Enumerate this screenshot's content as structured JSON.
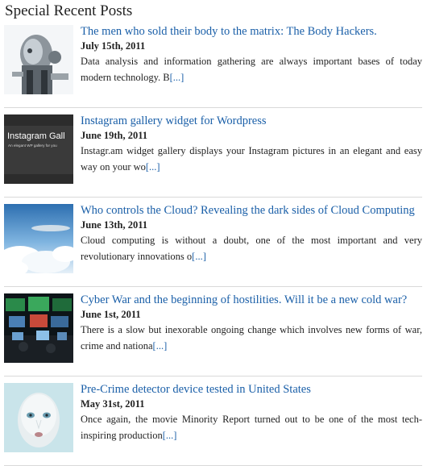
{
  "widget": {
    "title": "Special Recent Posts"
  },
  "posts": [
    {
      "title": "The men who sold their body to the matrix: The Body Hackers.",
      "date": "July 15th, 2011",
      "excerpt": "Data analysis and information gathering are always important bases of today modern technology. B",
      "more": "[...]",
      "thumb_icon": "robot-figure-thumbnail"
    },
    {
      "title": "Instagram gallery widget for Wordpress",
      "date": "June 19th, 2011",
      "excerpt": "Instagr.am widget gallery displays your Instagram pictures in an elegant and easy way on your wo",
      "more": "[...]",
      "thumb_icon": "instagram-gallery-thumbnail",
      "thumb_text": "Instagram Gall",
      "thumb_subtext": "An elegant WP gallery for you"
    },
    {
      "title": "Who controls the Cloud? Revealing the dark sides of Cloud Computing",
      "date": "June 13th, 2011",
      "excerpt": "Cloud computing is without a doubt, one of the most important and very revolutionary innovations o",
      "more": "[...]",
      "thumb_icon": "sky-clouds-thumbnail"
    },
    {
      "title": "Cyber War and the beginning of hostilities. Will it be a new cold war?",
      "date": "June 1st, 2011",
      "excerpt": "There is a slow but inexorable ongoing change which involves new forms of war, crime and nationa",
      "more": "[...]",
      "thumb_icon": "control-room-thumbnail"
    },
    {
      "title": "Pre-Crime detector device tested in United States",
      "date": "May 31st, 2011",
      "excerpt": "Once again, the movie Minority Report turned out to be one of the most tech-inspiring production",
      "more": "[...]",
      "thumb_icon": "face-portrait-thumbnail"
    }
  ]
}
